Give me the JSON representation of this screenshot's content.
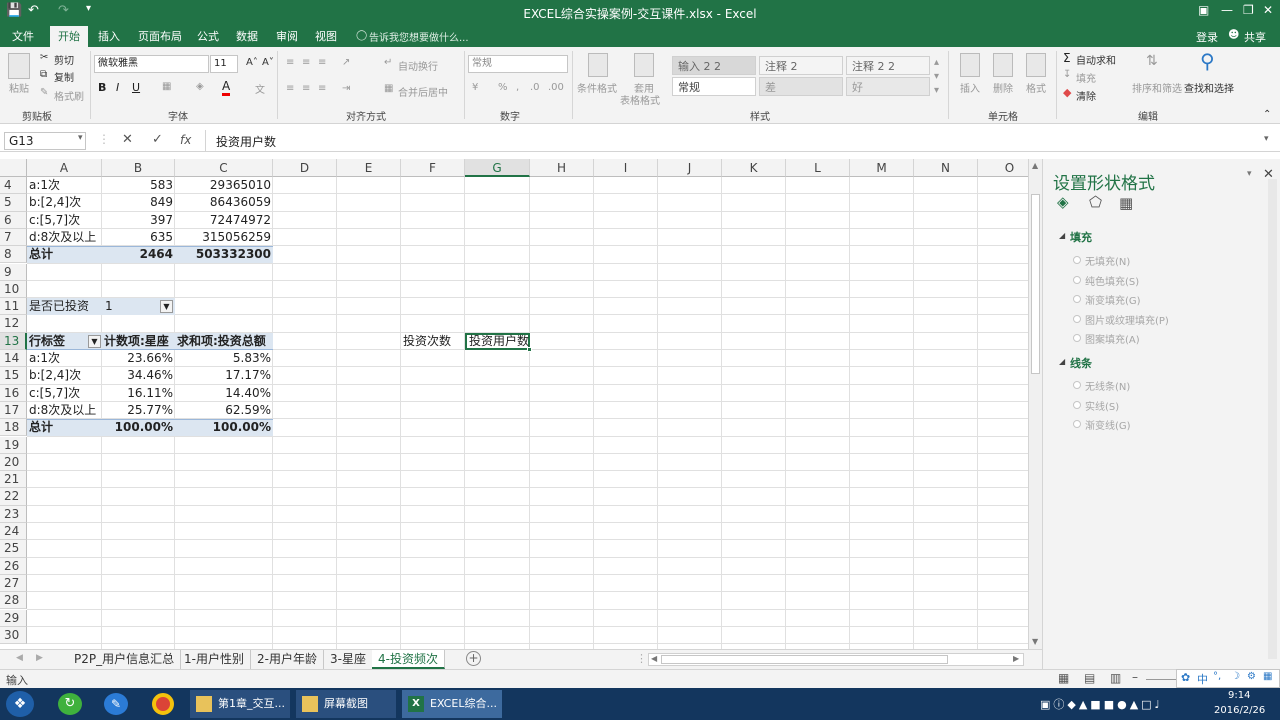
{
  "window": {
    "title": "EXCEL综合实操案例-交互课件.xlsx - Excel",
    "sign_in": "登录",
    "share": "共享"
  },
  "ribbon_tabs": [
    "文件",
    "开始",
    "插入",
    "页面布局",
    "公式",
    "数据",
    "审阅",
    "视图"
  ],
  "tell_me": "告诉我您想要做什么...",
  "clipboard": {
    "cut": "剪切",
    "copy": "复制",
    "format_painter": "格式刷",
    "paste": "粘贴",
    "label": "剪贴板"
  },
  "font": {
    "name": "微软雅黑",
    "size": "11",
    "label": "字体"
  },
  "alignment": {
    "wrap": "自动换行",
    "merge": "合并后居中",
    "label": "对齐方式"
  },
  "number": {
    "format": "常规",
    "label": "数字"
  },
  "styles": {
    "cond_format": "条件格式",
    "table_format_1": "套用",
    "table_format_2": "表格格式",
    "cells": [
      "输入 2 2",
      "注释 2",
      "注释 2 2",
      "常规",
      "差",
      "好"
    ],
    "label": "样式"
  },
  "cells_group": {
    "insert": "插入",
    "delete": "删除",
    "format": "格式",
    "label": "单元格"
  },
  "editing": {
    "autosum": "自动求和",
    "fill": "填充",
    "clear": "清除",
    "sort": "排序和筛选",
    "find": "查找和选择",
    "label": "编辑"
  },
  "formula_bar": {
    "name_box": "G13",
    "fx": "fx",
    "content": "投资用户数"
  },
  "columns": [
    "A",
    "B",
    "C",
    "D",
    "E",
    "F",
    "G",
    "H",
    "I",
    "J",
    "K",
    "L",
    "M",
    "N",
    "O"
  ],
  "rows": [
    "4",
    "5",
    "6",
    "7",
    "8",
    "9",
    "10",
    "11",
    "12",
    "13",
    "14",
    "15",
    "16",
    "17",
    "18",
    "19",
    "20",
    "21",
    "22",
    "23",
    "24",
    "25",
    "26",
    "27",
    "28",
    "29",
    "30"
  ],
  "table1": [
    [
      "a:1次",
      "583",
      "29365010"
    ],
    [
      "b:[2,4]次",
      "849",
      "86436059"
    ],
    [
      "c:[5,7]次",
      "397",
      "72474972"
    ],
    [
      "d:8次及以上",
      "635",
      "315056259"
    ],
    [
      "总计",
      "2464",
      "503332300"
    ]
  ],
  "filter": {
    "label": "是否已投资",
    "value": "1"
  },
  "table2_header": [
    "行标签",
    "计数项:星座",
    "求和项:投资总额"
  ],
  "table2": [
    [
      "a:1次",
      "23.66%",
      "5.83%"
    ],
    [
      "b:[2,4]次",
      "34.46%",
      "17.17%"
    ],
    [
      "c:[5,7]次",
      "16.11%",
      "14.40%"
    ],
    [
      "d:8次及以上",
      "25.77%",
      "62.59%"
    ],
    [
      "总计",
      "100.00%",
      "100.00%"
    ]
  ],
  "f13": "投资次数",
  "g13": "投资用户数",
  "sheets": [
    "P2P_用户信息汇总",
    "1-用户性别",
    "2-用户年龄",
    "3-星座",
    "4-投资频次"
  ],
  "status": "输入",
  "pane": {
    "title": "设置形状格式",
    "fill_section": "填充",
    "fill_options": [
      "无填充(N)",
      "纯色填充(S)",
      "渐变填充(G)",
      "图片或纹理填充(P)",
      "图案填充(A)"
    ],
    "line_section": "线条",
    "line_options": [
      "无线条(N)",
      "实线(S)",
      "渐变线(G)"
    ]
  },
  "taskbar": {
    "items": [
      "第1章_交互...",
      "屏幕截图",
      "EXCEL综合..."
    ],
    "time": "9:14",
    "date": "2016/2/26",
    "ime": "中"
  },
  "colors": {
    "brand": "#217346",
    "taskbar": "#13365e"
  }
}
